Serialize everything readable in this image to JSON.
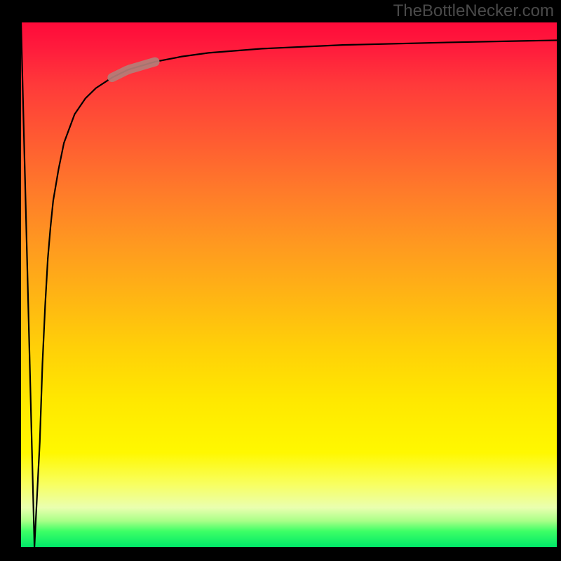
{
  "watermark": "TheBottleNecker.com",
  "colors": {
    "frame": "#000000",
    "curve": "#000000",
    "highlight": "#b47e78",
    "watermark_text": "#4a4a4a"
  },
  "chart_data": {
    "type": "line",
    "title": "",
    "xlabel": "",
    "ylabel": "",
    "xlim": [
      0,
      100
    ],
    "ylim": [
      0,
      100
    ],
    "x": [
      0,
      2.5,
      3.5,
      4,
      4.5,
      5,
      5.5,
      6,
      7,
      8,
      10,
      12,
      14,
      17,
      20,
      25,
      30,
      35,
      45,
      60,
      80,
      100
    ],
    "values": [
      100,
      0,
      20,
      35,
      46,
      55,
      61,
      66,
      72,
      77,
      82.5,
      85.5,
      87.5,
      89.5,
      91,
      92.5,
      93.5,
      94.2,
      95,
      95.7,
      96.2,
      96.6
    ],
    "highlight_segment": {
      "x_start": 17,
      "x_end": 25
    },
    "background_gradient": "vertical red-yellow-green heatmap"
  }
}
